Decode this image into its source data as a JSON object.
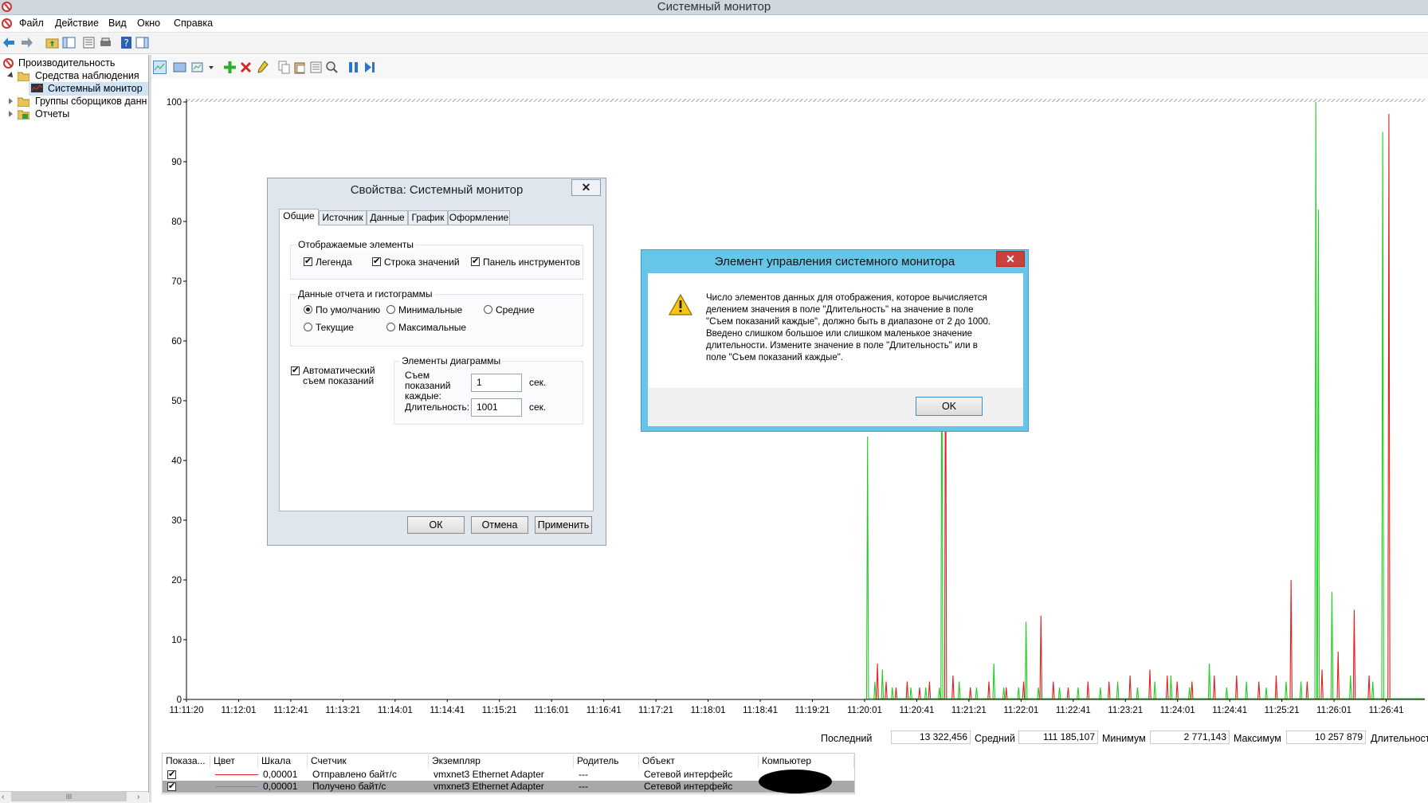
{
  "window": {
    "title": "Системный монитор"
  },
  "menu": [
    "Файл",
    "Действие",
    "Вид",
    "Окно",
    "Справка"
  ],
  "tree": {
    "items": [
      {
        "label": "Производительность",
        "level": 0,
        "expander": "none",
        "icon": "perf-icon"
      },
      {
        "label": "Средства наблюдения",
        "level": 1,
        "expander": "expanded",
        "icon": "folder-icon"
      },
      {
        "label": "Системный монитор",
        "level": 2,
        "expander": "none",
        "icon": "monitor-icon",
        "selected": true
      },
      {
        "label": "Группы сборщиков данн",
        "level": 1,
        "expander": "collapsed",
        "icon": "folder-icon"
      },
      {
        "label": "Отчеты",
        "level": 1,
        "expander": "collapsed",
        "icon": "report-icon"
      }
    ],
    "scroll_grip": "III"
  },
  "chart_data": {
    "type": "line",
    "y_ticks": [
      "100",
      "90",
      "80",
      "70",
      "60",
      "50",
      "40",
      "30",
      "20",
      "10",
      "0"
    ],
    "ylim": [
      0,
      100
    ],
    "x_ticks": [
      "11:11:20",
      "11:12:01",
      "11:12:41",
      "11:13:21",
      "11:14:01",
      "11:14:41",
      "11:15:21",
      "11:16:01",
      "11:16:41",
      "11:17:21",
      "11:18:01",
      "11:18:41",
      "11:19:21",
      "11:20:01",
      "11:20:41",
      "11:21:21",
      "11:22:01",
      "11:22:41",
      "11:23:21",
      "11:24:01",
      "11:24:41",
      "11:25:21",
      "11:26:01",
      "11:26:41"
    ],
    "grid": false,
    "series": [
      {
        "name": "Отправлено байт/с",
        "color": "#e21d1d",
        "spikes": [
          [
            0.558,
            6
          ],
          [
            0.565,
            3
          ],
          [
            0.573,
            2
          ],
          [
            0.582,
            3
          ],
          [
            0.592,
            2
          ],
          [
            0.6,
            3
          ],
          [
            0.613,
            72
          ],
          [
            0.619,
            4
          ],
          [
            0.633,
            2
          ],
          [
            0.648,
            3
          ],
          [
            0.662,
            2
          ],
          [
            0.676,
            3
          ],
          [
            0.69,
            14
          ],
          [
            0.7,
            3
          ],
          [
            0.712,
            2
          ],
          [
            0.728,
            3
          ],
          [
            0.745,
            3
          ],
          [
            0.762,
            4
          ],
          [
            0.778,
            5
          ],
          [
            0.792,
            4
          ],
          [
            0.8,
            3
          ],
          [
            0.812,
            3
          ],
          [
            0.83,
            4
          ],
          [
            0.848,
            4
          ],
          [
            0.866,
            3
          ],
          [
            0.88,
            4
          ],
          [
            0.892,
            20
          ],
          [
            0.905,
            3
          ],
          [
            0.917,
            5
          ],
          [
            0.93,
            8
          ],
          [
            0.943,
            15
          ],
          [
            0.955,
            4
          ],
          [
            0.971,
            98
          ]
        ]
      },
      {
        "name": "Получено байт/с",
        "color": "#22cc22",
        "spikes": [
          [
            0.55,
            44
          ],
          [
            0.556,
            3
          ],
          [
            0.562,
            5
          ],
          [
            0.57,
            2
          ],
          [
            0.585,
            2
          ],
          [
            0.597,
            2
          ],
          [
            0.608,
            2
          ],
          [
            0.61,
            70
          ],
          [
            0.624,
            3
          ],
          [
            0.638,
            2
          ],
          [
            0.652,
            6
          ],
          [
            0.66,
            2
          ],
          [
            0.672,
            2
          ],
          [
            0.678,
            13
          ],
          [
            0.688,
            2
          ],
          [
            0.705,
            2
          ],
          [
            0.72,
            2
          ],
          [
            0.738,
            2
          ],
          [
            0.752,
            3
          ],
          [
            0.768,
            2
          ],
          [
            0.782,
            3
          ],
          [
            0.795,
            4
          ],
          [
            0.81,
            2
          ],
          [
            0.826,
            6
          ],
          [
            0.84,
            2
          ],
          [
            0.856,
            3
          ],
          [
            0.872,
            2
          ],
          [
            0.888,
            3
          ],
          [
            0.9,
            3
          ],
          [
            0.912,
            100
          ],
          [
            0.914,
            82
          ],
          [
            0.925,
            18
          ],
          [
            0.94,
            4
          ],
          [
            0.958,
            3
          ],
          [
            0.966,
            95
          ]
        ]
      }
    ]
  },
  "valuebar": {
    "last_label": "Последний",
    "last_value": "13 322,456",
    "avg_label": "Средний",
    "avg_value": "111 185,107",
    "min_label": "Минимум",
    "min_value": "2 771,143",
    "max_label": "Максимум",
    "max_value": "10 257 879",
    "duration_label": "Длительность"
  },
  "legend": {
    "headers": [
      "Показа...",
      "Цвет",
      "Шкала",
      "Счетчик",
      "Экземпляр",
      "Родитель",
      "Объект",
      "Компьютер"
    ],
    "rows": [
      {
        "checked": true,
        "color": "#e21d1d",
        "scale": "0,00001",
        "counter": "Отправлено байт/с",
        "instance": "vmxnet3 Ethernet Adapter",
        "parent": "---",
        "object": "Сетевой интерфейс"
      },
      {
        "checked": true,
        "color": "#22cc22",
        "scale": "0,00001",
        "counter": "Получено байт/с",
        "instance": "vmxnet3 Ethernet Adapter",
        "parent": "---",
        "object": "Сетевой интерфейс",
        "selected": true
      }
    ]
  },
  "props_dialog": {
    "title": "Свойства: Системный монитор",
    "close": "✕",
    "tabs": [
      "Общие",
      "Источник",
      "Данные",
      "График",
      "Оформление"
    ],
    "group1": {
      "label": "Отображаемые элементы",
      "items": [
        "Легенда",
        "Строка значений",
        "Панель инструментов"
      ]
    },
    "group2": {
      "label": "Данные отчета и гистограммы",
      "options": [
        "По умолчанию",
        "Минимальные",
        "Средние",
        "Текущие",
        "Максимальные"
      ]
    },
    "auto_sample": "Автоматический съем показаний",
    "group3": {
      "label": "Элементы диаграммы",
      "sample_label": "Съем показаний каждые:",
      "sample_value": "1",
      "sample_unit": "сек.",
      "duration_label": "Длительность:",
      "duration_value": "1001",
      "duration_unit": "сек."
    },
    "buttons": {
      "ok": "ОК",
      "cancel": "Отмена",
      "apply": "Применить"
    }
  },
  "msg_dialog": {
    "title": "Элемент управления системного монитора",
    "close": "✕",
    "lines": [
      "Число элементов данных для отображения, которое вычисляется",
      "делением значения в поле \"Длительность\" на значение в поле",
      "\"Съем показаний каждые\", должно быть в диапазоне от 2 до 1000.",
      "Введено слишком большое или слишком маленькое значение",
      "длительности. Измените значение в поле \"Длительность\" или в",
      "поле \"Съем показаний каждые\"."
    ],
    "ok": "OK"
  }
}
